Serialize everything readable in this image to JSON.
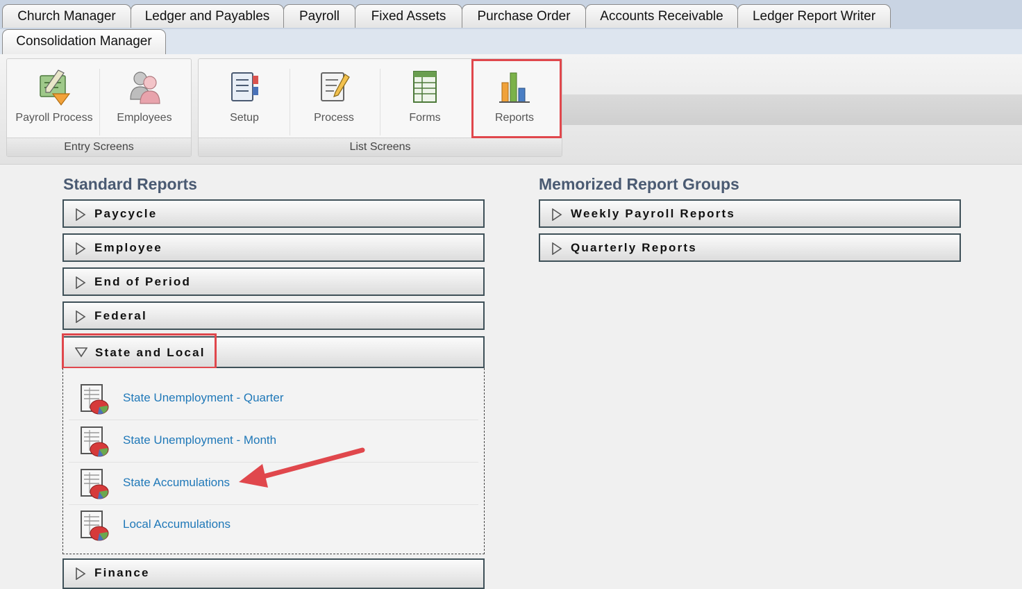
{
  "tabs": {
    "row1": [
      "Church Manager",
      "Ledger and Payables",
      "Payroll",
      "Fixed Assets",
      "Purchase Order",
      "Accounts Receivable",
      "Ledger Report Writer"
    ],
    "row2": [
      "Consolidation Manager"
    ]
  },
  "toolbar": {
    "entry_group": {
      "label": "Entry Screens",
      "buttons": [
        {
          "label": "Payroll Process",
          "icon": "payroll-process-icon"
        },
        {
          "label": "Employees",
          "icon": "employees-icon"
        }
      ]
    },
    "list_group": {
      "label": "List Screens",
      "buttons": [
        {
          "label": "Setup",
          "icon": "setup-icon"
        },
        {
          "label": "Process",
          "icon": "process-icon"
        },
        {
          "label": "Forms",
          "icon": "forms-icon"
        },
        {
          "label": "Reports",
          "icon": "reports-icon",
          "highlighted": true
        }
      ]
    }
  },
  "standard_reports": {
    "title": "Standard Reports",
    "sections": [
      {
        "label": "Paycycle",
        "expanded": false
      },
      {
        "label": "Employee",
        "expanded": false
      },
      {
        "label": "End of Period",
        "expanded": false
      },
      {
        "label": "Federal",
        "expanded": false
      },
      {
        "label": "State and Local",
        "expanded": true,
        "highlighted": true,
        "items": [
          "State Unemployment - Quarter",
          "State Unemployment - Month",
          "State Accumulations",
          "Local Accumulations"
        ]
      },
      {
        "label": "Finance",
        "expanded": false
      }
    ]
  },
  "memorized_groups": {
    "title": "Memorized Report Groups",
    "sections": [
      {
        "label": "Weekly Payroll Reports"
      },
      {
        "label": "Quarterly Reports"
      }
    ]
  },
  "colors": {
    "link": "#1f78b8",
    "title": "#4a5a72",
    "highlight": "#e0474c",
    "accordion_border": "#3e5058"
  }
}
